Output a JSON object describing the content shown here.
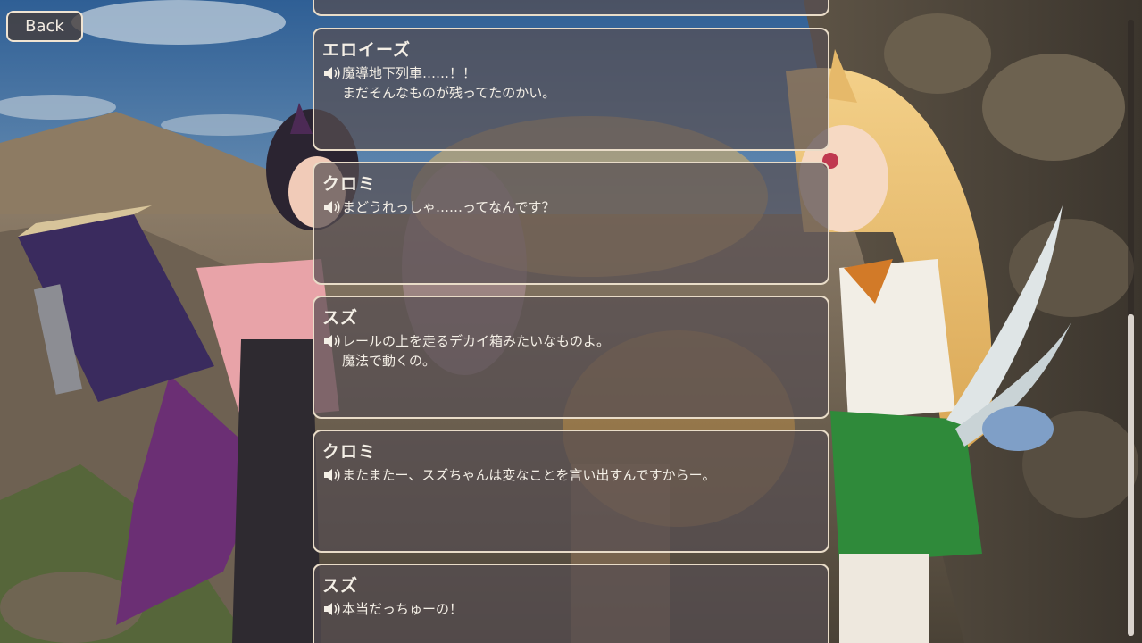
{
  "nav": {
    "back_label": "Back"
  },
  "backlog": {
    "entries": [
      {
        "speaker": "エロイーズ",
        "text": "魔導地下列車……！！\nまだそんなものが残ってたのかい。"
      },
      {
        "speaker": "クロミ",
        "text": "まどうれっしゃ……ってなんです？"
      },
      {
        "speaker": "スズ",
        "text": "レールの上を走るデカイ箱みたいなものよ。\n魔法で動くの。"
      },
      {
        "speaker": "クロミ",
        "text": "またまたー、スズちゃんは変なことを言い出すんですからー。"
      },
      {
        "speaker": "スズ",
        "text": "本当だっちゅーの！"
      }
    ]
  },
  "scroll": {
    "position_fraction": 0.92
  }
}
